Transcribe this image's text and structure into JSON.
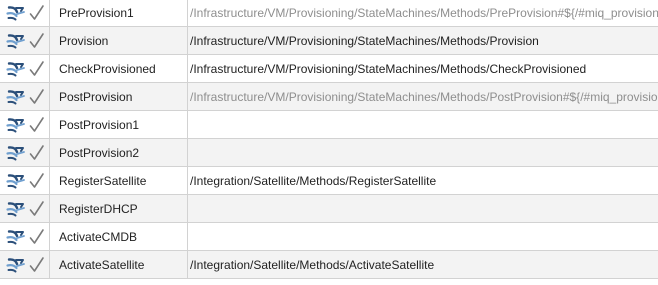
{
  "rows": [
    {
      "name": "PreProvision1",
      "value": "/Infrastructure/VM/Provisioning/StateMachines/Methods/PreProvision#${/#miq_provision.source.platform}",
      "dim": true
    },
    {
      "name": "Provision",
      "value": "/Infrastructure/VM/Provisioning/StateMachines/Methods/Provision",
      "dim": false
    },
    {
      "name": "CheckProvisioned",
      "value": "/Infrastructure/VM/Provisioning/StateMachines/Methods/CheckProvisioned",
      "dim": false
    },
    {
      "name": "PostProvision",
      "value": "/Infrastructure/VM/Provisioning/StateMachines/Methods/PostProvision#${/#miq_provision.source.platform}",
      "dim": true
    },
    {
      "name": "PostProvision1",
      "value": "",
      "dim": false
    },
    {
      "name": "PostProvision2",
      "value": "",
      "dim": false
    },
    {
      "name": "RegisterSatellite",
      "value": "/Integration/Satellite/Methods/RegisterSatellite",
      "dim": false
    },
    {
      "name": "RegisterDHCP",
      "value": "",
      "dim": false
    },
    {
      "name": "ActivateCMDB",
      "value": "",
      "dim": false
    },
    {
      "name": "ActivateSatellite",
      "value": "/Integration/Satellite/Methods/ActivateSatellite",
      "dim": false
    }
  ],
  "icons": {
    "state": "state-icon",
    "checkmark": "checkmark-icon"
  },
  "colors": {
    "state_icon_dark": "#2b4f7a",
    "state_icon_light": "#6f9fcf",
    "checkmark": "#7a7a7a",
    "dim_text": "#8e8e8e",
    "stripe": "#f3f3f3",
    "border": "#d2d2d2"
  }
}
